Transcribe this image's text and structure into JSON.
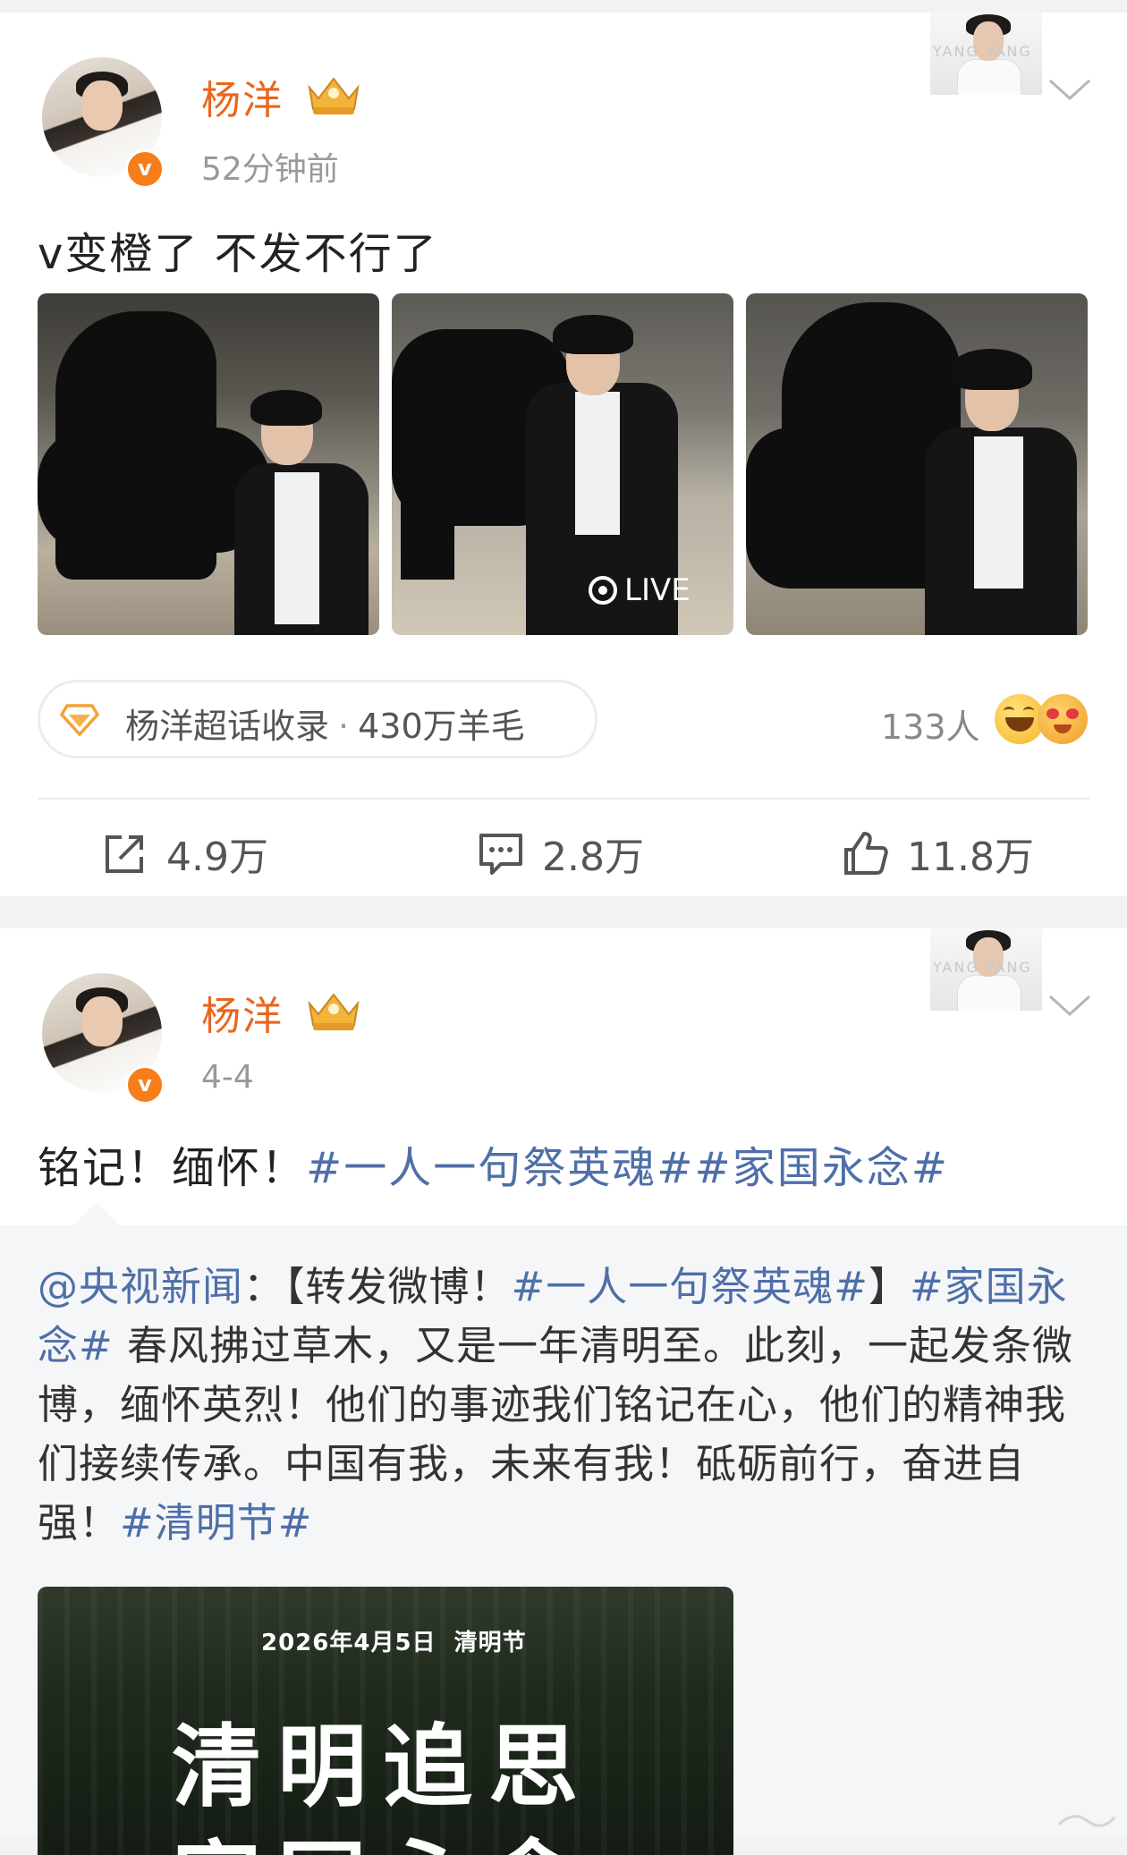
{
  "post1": {
    "username": "杨洋",
    "time": "52分钟前",
    "text": "v变橙了 不发不行了",
    "badge_letter": "v",
    "live_label": "LIVE",
    "supertopic": {
      "name": "杨洋超话收录",
      "separator": "·",
      "count": "430万羊毛"
    },
    "reactions_people": "133人",
    "actions": {
      "share": "4.9万",
      "comment": "2.8万",
      "like": "11.8万"
    }
  },
  "post2": {
    "username": "杨洋",
    "time": "4-4",
    "badge_letter": "v",
    "text_plain": "铭记！缅怀！",
    "tag1": "#一人一句祭英魂#",
    "tag2": "#家国永念#",
    "retweet": {
      "mention": "@央视新闻",
      "colon": "：【转发微博！",
      "tag_a": "#一人一句祭英魂#",
      "bracket_close": "】",
      "tag_b": "#家国永念#",
      "body": "春风拂过草木，又是一年清明至。此刻，一起发条微博，缅怀英烈！他们的事迹我们铭记在心，他们的精神我们接续传承。中国有我，未来有我！砥砺前行，奋进自强！",
      "tag_c": "#清明节#",
      "poster": {
        "date": "2026年4月5日",
        "festival": "清明节",
        "title_line1": "清明追思",
        "title_line2": "家国永念"
      }
    }
  },
  "corner_badge_text": "YANG YANG",
  "colors": {
    "username": "#e8661e",
    "verified_badge": "#f77d1a",
    "link": "#4e6fa8"
  }
}
